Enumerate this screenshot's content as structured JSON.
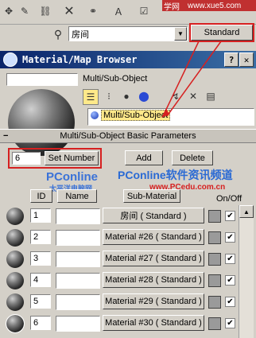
{
  "toolbar": {
    "scene_dropdown_value": "房间",
    "standard_button": "Standard",
    "watermark_site": "学网",
    "watermark_url": "www.xue5.com"
  },
  "browser": {
    "title": "Material/Map Browser",
    "name_field": "",
    "type_label": "Multi/Sub-Object",
    "selected_item": "Multi/Sub-Object"
  },
  "rollout": {
    "title": "Multi/Sub-Object Basic Parameters",
    "count_value": "6",
    "set_number": "Set Number",
    "add": "Add",
    "delete": "Delete",
    "col_id": "ID",
    "col_name": "Name",
    "col_submat": "Sub-Material",
    "col_onoff": "On/Off"
  },
  "watermark": {
    "pconline": "PConline",
    "pconline_cn": "软件资讯频道",
    "sub_left": "太平洋电脑网",
    "sub_url": "www.PCedu.com.cn"
  },
  "rows": [
    {
      "id": "1",
      "name": "",
      "material": "房间 ( Standard )",
      "on": "✔"
    },
    {
      "id": "2",
      "name": "",
      "material": "Material #26  ( Standard )",
      "on": "✔"
    },
    {
      "id": "3",
      "name": "",
      "material": "Material #27  ( Standard )",
      "on": "✔"
    },
    {
      "id": "4",
      "name": "",
      "material": "Material #28  ( Standard )",
      "on": "✔"
    },
    {
      "id": "5",
      "name": "",
      "material": "Material #29  ( Standard )",
      "on": "✔"
    },
    {
      "id": "6",
      "name": "",
      "material": "Material #30  ( Standard )",
      "on": "✔"
    }
  ],
  "colors": {
    "red": "#d62020",
    "title_blue": "#0a246a",
    "highlight": "#ffe98a"
  },
  "icons": [
    "pin-icon",
    "link-icon",
    "select-icon",
    "close-icon",
    "eyedropper-icon",
    "browser-icon",
    "help-icon",
    "list-view-icon",
    "sphere-icon"
  ]
}
